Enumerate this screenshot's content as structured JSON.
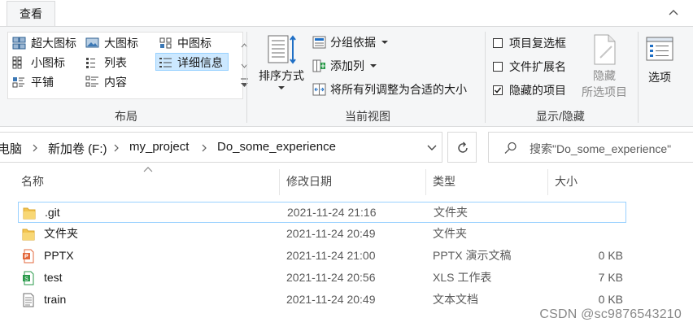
{
  "tabs": {
    "view": "查看"
  },
  "ribbon": {
    "layout": {
      "label": "布局",
      "items": [
        {
          "label": "超大图标",
          "icon": "extra-large-icons-icon"
        },
        {
          "label": "大图标",
          "icon": "large-icons-icon"
        },
        {
          "label": "中图标",
          "icon": "medium-icons-icon"
        },
        {
          "label": "小图标",
          "icon": "small-icons-icon"
        },
        {
          "label": "列表",
          "icon": "list-icon"
        },
        {
          "label": "详细信息",
          "icon": "details-icon",
          "selected": true
        },
        {
          "label": "平铺",
          "icon": "tiles-icon"
        },
        {
          "label": "内容",
          "icon": "content-icon"
        }
      ]
    },
    "current_view": {
      "label": "当前视图",
      "sort_by": "排序方式",
      "group_by": "分组依据",
      "add_column": "添加列",
      "size_all_columns": "将所有列调整为合适的大小"
    },
    "show_hide": {
      "label": "显示/隐藏",
      "item_checkboxes": {
        "label": "项目复选框",
        "checked": false
      },
      "file_extensions": {
        "label": "文件扩展名",
        "checked": false
      },
      "hidden_items": {
        "label": "隐藏的项目",
        "checked": true
      },
      "hide_selected_line1": "隐藏",
      "hide_selected_line2": "所选项目"
    },
    "options": "选项"
  },
  "address": {
    "crumbs": [
      "电脑",
      "新加卷 (F:)",
      "my_project",
      "Do_some_experience"
    ]
  },
  "search": {
    "placeholder": "搜索\"Do_some_experience\""
  },
  "columns": {
    "name": "名称",
    "date": "修改日期",
    "type": "类型",
    "size": "大小"
  },
  "files": [
    {
      "name": ".git",
      "date": "2021-11-24 21:16",
      "type": "文件夹",
      "size": "",
      "icon": "folder-icon"
    },
    {
      "name": "文件夹",
      "date": "2021-11-24 20:49",
      "type": "文件夹",
      "size": "",
      "icon": "folder-icon"
    },
    {
      "name": "PPTX",
      "date": "2021-11-24 21:00",
      "type": "PPTX 演示文稿",
      "size": "0 KB",
      "icon": "pptx-file-icon"
    },
    {
      "name": "test",
      "date": "2021-11-24 20:56",
      "type": "XLS 工作表",
      "size": "7 KB",
      "icon": "xls-file-icon"
    },
    {
      "name": "train",
      "date": "2021-11-24 20:49",
      "type": "文本文档",
      "size": "0 KB",
      "icon": "text-file-icon"
    }
  ],
  "watermark": "CSDN @sc9876543210",
  "colors": {
    "selection": "#cce8ff",
    "selection_border": "#99d1ff",
    "folder": "#f2c450",
    "pptx": "#e3693c",
    "xls": "#2a9a4a",
    "accent_blue": "#1f6fc5"
  }
}
